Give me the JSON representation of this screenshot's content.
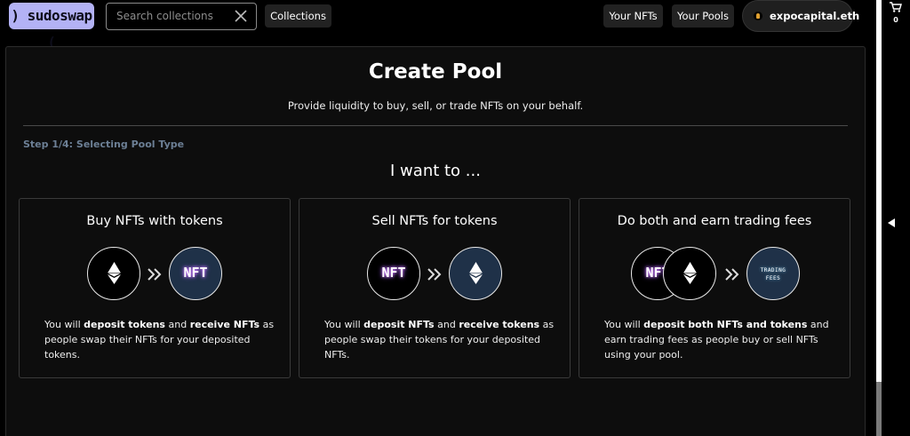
{
  "nav": {
    "logo": ") sudoswap (",
    "search_placeholder": "Search collections",
    "collections_label": "Collections",
    "your_nfts_label": "Your NFTs",
    "your_pools_label": "Your Pools",
    "wallet_name": "expocapital.eth"
  },
  "side": {
    "cart_count": "0"
  },
  "main": {
    "title": "Create Pool",
    "subtitle": "Provide liquidity to buy, sell, or trade NFTs on your behalf.",
    "step": "Step 1/4: Selecting Pool Type",
    "prompt": "I want to ...",
    "cards": [
      {
        "title": "Buy NFTs with tokens",
        "desc": [
          {
            "t": "You will ",
            "b": false
          },
          {
            "t": "deposit tokens",
            "b": true
          },
          {
            "t": " and ",
            "b": false
          },
          {
            "t": "receive NFTs",
            "b": true
          },
          {
            "t": " as people swap their NFTs for your deposited tokens.",
            "b": false
          }
        ]
      },
      {
        "title": "Sell NFTs for tokens",
        "desc": [
          {
            "t": "You will ",
            "b": false
          },
          {
            "t": "deposit NFTs",
            "b": true
          },
          {
            "t": " and ",
            "b": false
          },
          {
            "t": "receive tokens",
            "b": true
          },
          {
            "t": " as people swap their tokens for your deposited NFTs.",
            "b": false
          }
        ]
      },
      {
        "title": "Do both and earn trading fees",
        "desc": [
          {
            "t": "You will ",
            "b": false
          },
          {
            "t": "deposit both NFTs and tokens",
            "b": true
          },
          {
            "t": " and earn trading fees as people buy or sell NFTs using your pool.",
            "b": false
          }
        ]
      }
    ],
    "nft_badge": "NFT",
    "fees_badge_line1": "TRADING",
    "fees_badge_line2": "FEES"
  },
  "colors": {
    "logo_bg": "#b3b2f5",
    "step_text": "#6c7f95",
    "navy_circle": "#1f3148"
  },
  "icons": [
    "search-icon",
    "close-icon",
    "cart-icon",
    "ethereum-icon",
    "double-chevron-right-icon",
    "collapse-arrow-icon"
  ]
}
